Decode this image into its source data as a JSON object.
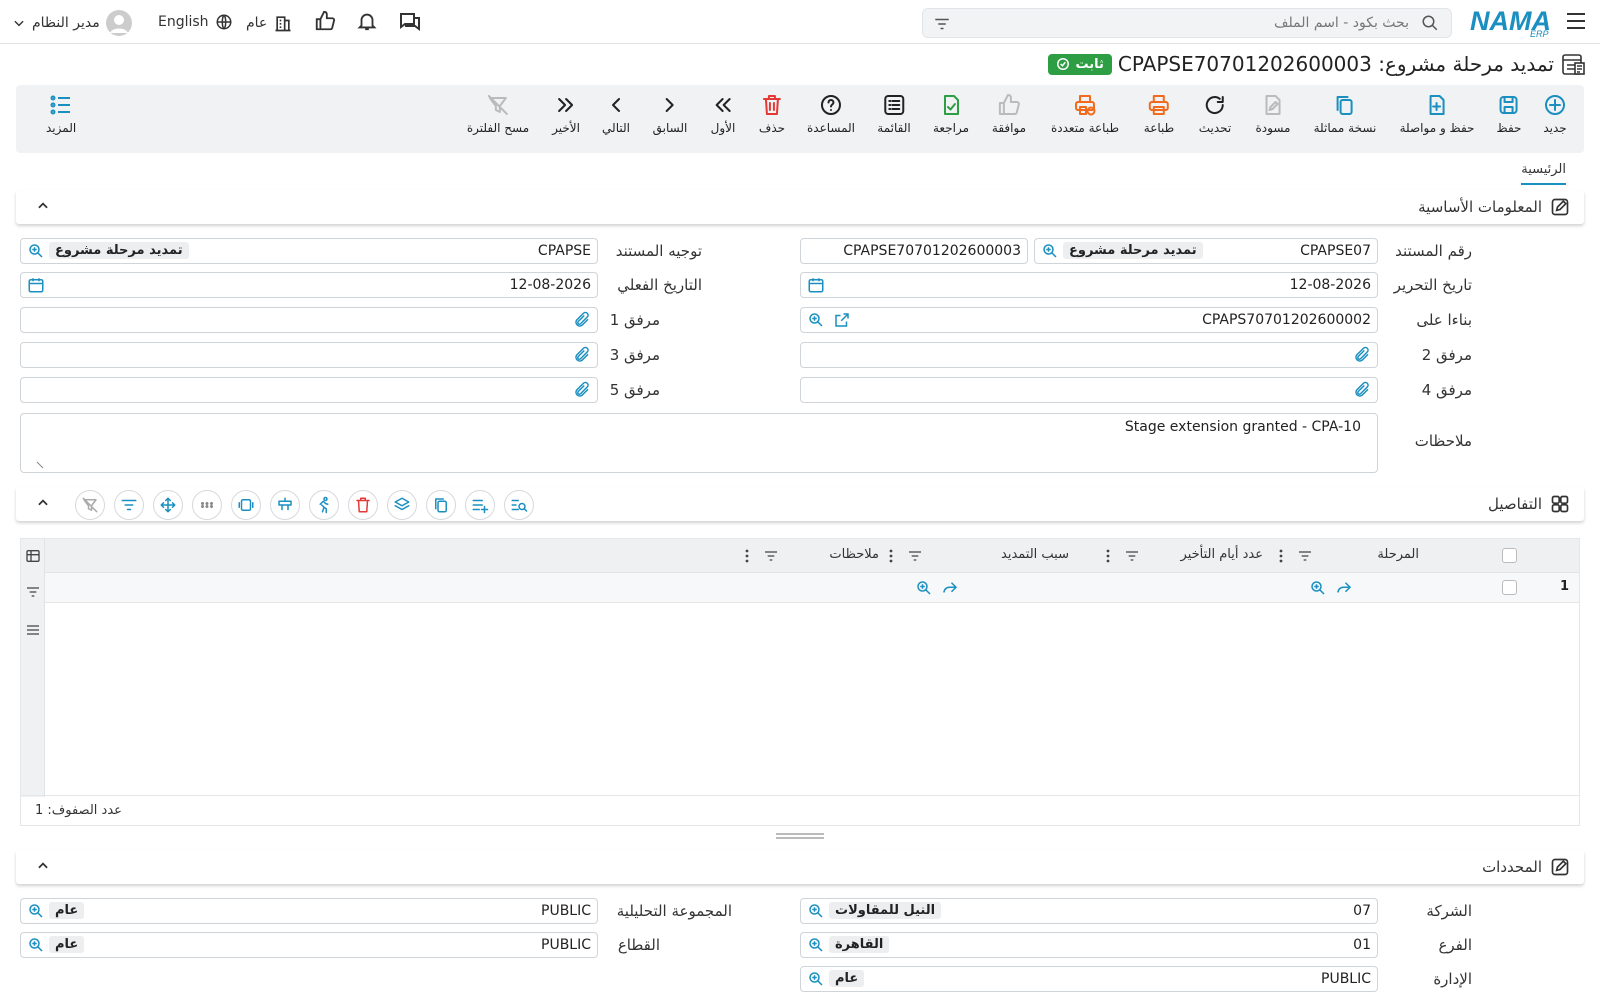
{
  "topbar": {
    "search_placeholder": "بحث بكود - اسم الملف",
    "logo": "NAMA",
    "logo_sub": "ERP",
    "language": "English",
    "company_scope": "عام",
    "user": "مدير النظام"
  },
  "header": {
    "title": "تمديد مرحلة مشروع: CPAPSE70701202600003",
    "status": "ثابت"
  },
  "toolbar": {
    "buttons": [
      {
        "label": "جديد",
        "icon": "plus-circle-icon"
      },
      {
        "label": "حفظ",
        "icon": "save-icon"
      },
      {
        "label": "حفظ و مواصلة",
        "icon": "save-continue-icon"
      },
      {
        "label": "نسخة مماثلة",
        "icon": "duplicate-icon"
      },
      {
        "label": "مسودة",
        "icon": "draft-icon"
      },
      {
        "label": "تحديث",
        "icon": "refresh-icon"
      },
      {
        "label": "طباعة",
        "icon": "print-icon"
      },
      {
        "label": "طباعة متعددة",
        "icon": "multi-print-icon"
      },
      {
        "label": "موافقة",
        "icon": "thumbs-up-icon"
      },
      {
        "label": "مراجعة",
        "icon": "review-icon"
      },
      {
        "label": "القائمة",
        "icon": "list-icon"
      },
      {
        "label": "المساعدة",
        "icon": "help-icon"
      },
      {
        "label": "حذف",
        "icon": "trash-icon"
      },
      {
        "label": "الأول",
        "icon": "first-icon"
      },
      {
        "label": "السابق",
        "icon": "prev-icon"
      },
      {
        "label": "التالي",
        "icon": "next-icon"
      },
      {
        "label": "الأخير",
        "icon": "last-icon"
      },
      {
        "label": "مسح الفلترة",
        "icon": "clear-filter-icon"
      }
    ],
    "more_label": "المزيد"
  },
  "tabs": {
    "main": "الرئيسية"
  },
  "basic": {
    "title": "المعلومات الأساسية",
    "doc_no_label": "رقم المستند",
    "doc_no_prefix": "CPAPSE07",
    "doc_no_type": "تمديد مرحلة مشروع",
    "doc_no_value": "CPAPSE70701202600003",
    "direction_label": "توجيه المستند",
    "direction_value": "CPAPSE",
    "direction_tag": "تمديد مرحلة مشروع",
    "edit_date_label": "تاريخ التحرير",
    "edit_date_value": "12-08-2026",
    "actual_date_label": "التاريخ الفعلي",
    "actual_date_value": "12-08-2026",
    "based_on_label": "بناءا على",
    "based_on_value": "CPAPS70701202600002",
    "att1_label": "مرفق 1",
    "att2_label": "مرفق 2",
    "att3_label": "مرفق 3",
    "att4_label": "مرفق 4",
    "att5_label": "مرفق 5",
    "notes_label": "ملاحظات",
    "notes_value": "Stage extension granted - CPA-10"
  },
  "details": {
    "title": "التفاصيل",
    "columns": [
      "المرحلة",
      "عدد أيام التأخير",
      "سبب التمديد",
      "ملاحظات"
    ],
    "row_number": "1",
    "row_count_label": "عدد الصفوف: 1"
  },
  "dims": {
    "title": "المحددات",
    "company_label": "الشركة",
    "company_code": "07",
    "company_tag": "النيل للمقاولات",
    "analytic_label": "المجموعة التحليلية",
    "analytic_code": "PUBLIC",
    "analytic_tag": "عام",
    "branch_label": "الفرع",
    "branch_code": "01",
    "branch_tag": "القاهرة",
    "sector_label": "القطاع",
    "sector_code": "PUBLIC",
    "sector_tag": "عام",
    "dept_label": "الإدارة",
    "dept_code": "PUBLIC",
    "dept_tag": "عام"
  },
  "colors": {
    "accent": "#1a8fc0",
    "status_green": "#2e9e44",
    "danger": "#e53935",
    "print_orange": "#f26b1d"
  }
}
